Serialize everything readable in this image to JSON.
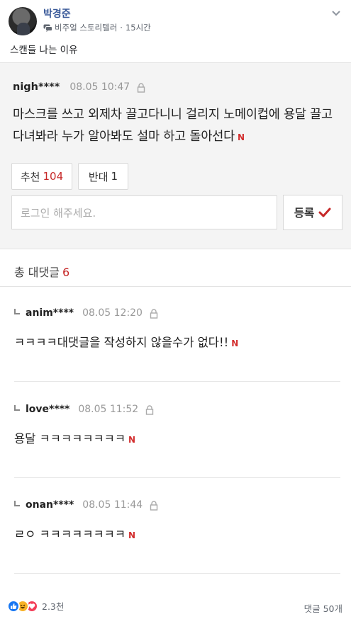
{
  "post": {
    "author": "박경준",
    "audience": "비주얼 스토리텔러",
    "time": "15시간",
    "caption": "스캔들 나는 이유"
  },
  "comment": {
    "user": "nigh****",
    "time": "08.05 10:47",
    "body": "마스크를 쓰고 외제차 끌고다니니 걸리지 노메이컵에 용달 끌고 다녀봐라 누가 알아봐도 설마 하고 돌아선다",
    "new_badge": "N",
    "upvote_label": "추천",
    "upvote_count": "104",
    "downvote_label": "반대",
    "downvote_count": "1",
    "input_placeholder": "로그인 해주세요.",
    "submit_label": "등록"
  },
  "replies_header": {
    "label": "총 대댓글",
    "count": "6"
  },
  "replies": [
    {
      "user": "anim****",
      "time": "08.05 12:20",
      "body": "ㅋㅋㅋㅋ대댓글을 작성하지 않을수가 없다!!",
      "badge": "N"
    },
    {
      "user": "love****",
      "time": "08.05 11:52",
      "body": "용달 ㅋㅋㅋㅋㅋㅋㅋㅋ",
      "badge": "N"
    },
    {
      "user": "onan****",
      "time": "08.05 11:44",
      "body": "ㄹㅇ ㅋㅋㅋㅋㅋㅋㅋㅋ",
      "badge": "N"
    }
  ],
  "footer": {
    "reaction_count": "2.3천",
    "comment_count": "댓글 50개"
  },
  "colors": {
    "link_blue": "#385898",
    "accent_red": "#c62828",
    "like_blue": "#1877f2",
    "haha_yellow": "#f7b125",
    "love_red": "#f33e58"
  }
}
